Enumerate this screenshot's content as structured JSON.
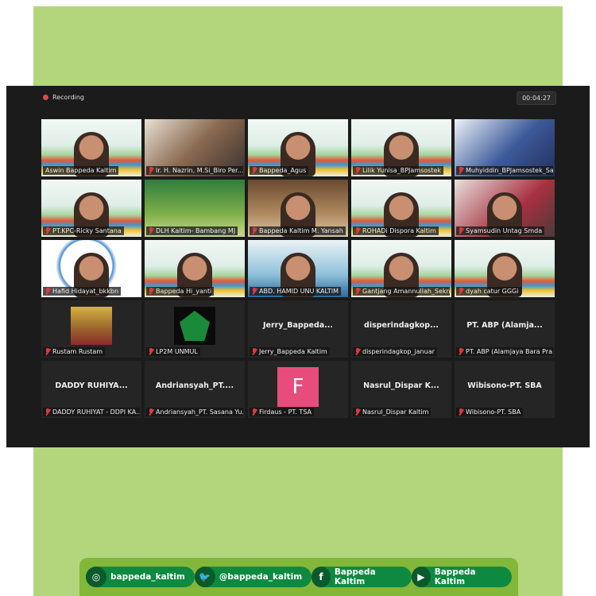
{
  "recording": {
    "label": "Recording",
    "timer": "00:04:27"
  },
  "tiles": [
    {
      "name": "Aswin Bappeda Kaltim",
      "video": "sdg",
      "active": true,
      "muted": false
    },
    {
      "name": "Ir. H. Nazrin, M.Si_Biro Per...",
      "video": "room",
      "muted": true
    },
    {
      "name": "Bappeda_Agus",
      "video": "sdg",
      "muted": true
    },
    {
      "name": "Lilik Yunisa_BPJamsostek",
      "video": "sdg",
      "muted": true
    },
    {
      "name": "Muhyiddin_BPJamsostek_Sa...",
      "video": "stage",
      "muted": true
    },
    {
      "name": "PT.KPC-Ricky Santana",
      "video": "sdg",
      "muted": true
    },
    {
      "name": "DLH Kaltim- Bambang MJ",
      "video": "dlh",
      "muted": true
    },
    {
      "name": "Bappeda Kaltim M. Yansah",
      "video": "brown",
      "muted": true
    },
    {
      "name": "ROHADi Dispora Kaltim",
      "video": "sdg",
      "muted": true
    },
    {
      "name": "Syamsudin Untag Smda",
      "video": "red",
      "muted": true
    },
    {
      "name": "Hafid Hidayat_bkkbn",
      "video": "asn",
      "muted": true
    },
    {
      "name": "Bappeda Hi_yanti",
      "video": "sdg",
      "muted": true
    },
    {
      "name": "ABD. HAMID UNU KALTIM",
      "video": "sky",
      "muted": true
    },
    {
      "name": "Gantjang Amannullah_Sekn...",
      "video": "sdg",
      "muted": true
    },
    {
      "name": "dyah catur GGGi",
      "video": "sdg",
      "muted": true
    },
    {
      "name": "Rustam Rustam",
      "thumb": "photo",
      "muted": true
    },
    {
      "name": "LP2M UNMUL",
      "thumb": "logo",
      "muted": true
    },
    {
      "name": "Jerry_Bappeda Kaltim",
      "display": "Jerry_Bappeda...",
      "muted": true
    },
    {
      "name": "disperindagkop_januar",
      "display": "disperindagkop...",
      "muted": true
    },
    {
      "name": "PT. ABP (Alamjaya Bara Pra...",
      "display": "PT. ABP (Alamja...",
      "muted": true
    },
    {
      "name": "DADDY RUHIYAT - DDPI KA...",
      "display": "DADDY RUHIYA...",
      "muted": true
    },
    {
      "name": "Andriansyah_PT. Sasana Yu...",
      "display": "Andriansyah_PT....",
      "muted": true
    },
    {
      "name": "Firdaus - PT. TSA",
      "avatar": "F",
      "muted": true
    },
    {
      "name": "Nasrul_Dispar Kaltim",
      "display": "Nasrul_Dispar  K...",
      "muted": true
    },
    {
      "name": "Wibisono-PT. SBA",
      "display": "Wibisono-PT. SBA",
      "muted": true
    }
  ],
  "footer": [
    {
      "icon": "instagram-icon",
      "glyph": "◎",
      "label": "bappeda_kaltim"
    },
    {
      "icon": "twitter-icon",
      "glyph": "🐦",
      "label": "@bappeda_kaltim"
    },
    {
      "icon": "facebook-icon",
      "glyph": "f",
      "label": "Bappeda Kaltim"
    },
    {
      "icon": "youtube-icon",
      "glyph": "▶",
      "label": "Bappeda Kaltim"
    }
  ],
  "colors": {
    "background_green": "#b3d67c",
    "footer_green": "#0e8a40",
    "recording_red": "#e0474c",
    "active_speaker": "#c6e06a",
    "avatar_pink": "#e84c7d"
  }
}
